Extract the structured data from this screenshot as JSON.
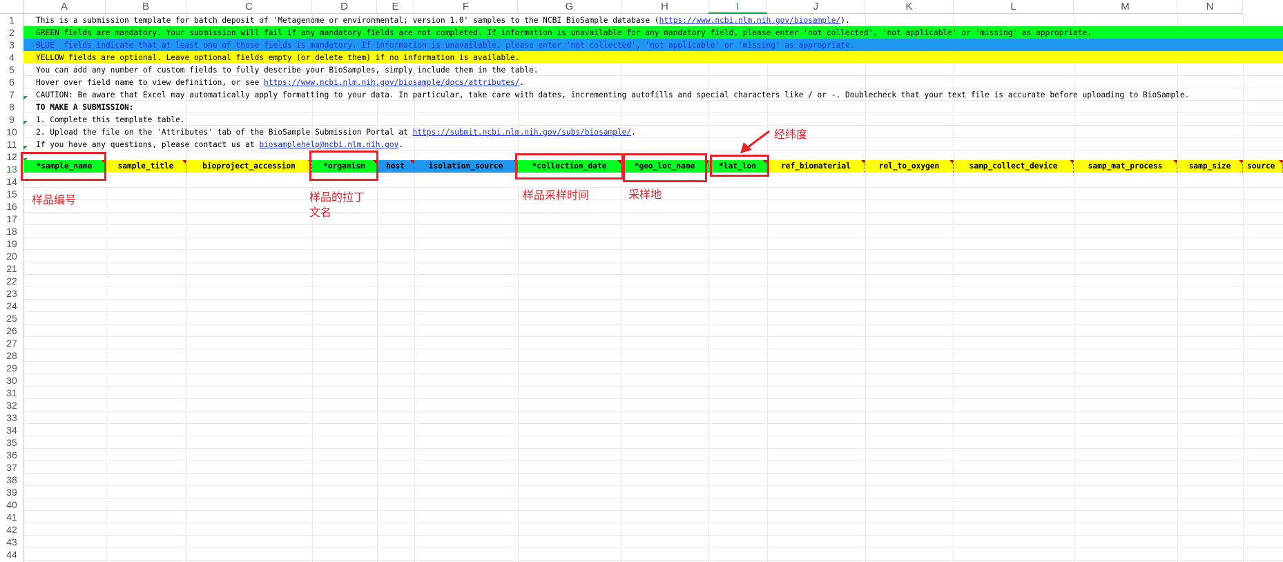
{
  "columns": [
    "A",
    "B",
    "C",
    "D",
    "E",
    "F",
    "G",
    "H",
    "I",
    "J",
    "K",
    "L",
    "M",
    "N"
  ],
  "selected_column": "I",
  "rows": [
    "1",
    "2",
    "3",
    "4",
    "5",
    "6",
    "7",
    "8",
    "9",
    "10",
    "11",
    "12",
    "13",
    "14",
    "15",
    "16",
    "17",
    "18",
    "19",
    "20",
    "21",
    "22",
    "23",
    "24",
    "25",
    "26",
    "27",
    "28",
    "29",
    "30",
    "31",
    "32",
    "33",
    "34",
    "35",
    "36",
    "37",
    "38",
    "39",
    "40",
    "41",
    "42",
    "43",
    "44"
  ],
  "selected_row": "13",
  "info_lines": {
    "line1_pre": "This is a submission template for batch deposit of 'Metagenome or environmental; version 1.0' samples to the NCBI BioSample database (",
    "line1_link": "https://www.ncbi.nlm.nih.gov/biosample/",
    "line1_post": ").",
    "line2": "GREEN fields are mandatory. Your submission will fail if any mandatory fields are not completed. If information is unavailable for any mandatory field, please enter 'not collected', 'not applicable' or 'missing' as appropriate.",
    "line3": "BLUE  fields indicate that at least one of those fields is mandatory. If information is unavailable, please enter 'not collected', 'not applicable' or 'missing' as appropriate.",
    "line4": "YELLOW fields are optional. Leave optional fields empty (or delete them) if no information is available.",
    "line5": "You can add any number of custom fields to fully describe your BioSamples, simply include them in the table.",
    "line6_pre": "Hover over field name to view definition, or see ",
    "line6_link": "https://www.ncbi.nlm.nih.gov/biosample/docs/attributes/",
    "line6_post": ".",
    "line7": "CAUTION: Be aware that Excel may automatically apply formatting to your data. In particular, take care with dates, incrementing autofills and special characters like / or -. Doublecheck that your text file is accurate before uploading to BioSample.",
    "line8": "TO MAKE A SUBMISSION:",
    "line9": "1. Complete this template table.",
    "line10_pre": "2. Upload the file on the 'Attributes' tab of the BioSample Submission Portal at ",
    "line10_link": "https://submit.ncbi.nlm.nih.gov/subs/biosample/",
    "line10_post": ".",
    "line11_pre": "If you have any questions, please contact us at ",
    "line11_link": "biosamplehelp@ncbi.nlm.nih.gov",
    "line11_post": "."
  },
  "header_fields": [
    {
      "name": "*sample_name",
      "color": "green"
    },
    {
      "name": "sample_title",
      "color": "yellow"
    },
    {
      "name": "bioproject_accession",
      "color": "yellow"
    },
    {
      "name": "*organism",
      "color": "green"
    },
    {
      "name": "host",
      "color": "blue"
    },
    {
      "name": "isolation_source",
      "color": "blue"
    },
    {
      "name": "*collection_date",
      "color": "green"
    },
    {
      "name": "*geo_loc_name",
      "color": "green"
    },
    {
      "name": "*lat_lon",
      "color": "green"
    },
    {
      "name": "ref_biomaterial",
      "color": "yellow"
    },
    {
      "name": "rel_to_oxygen",
      "color": "yellow"
    },
    {
      "name": "samp_collect_device",
      "color": "yellow"
    },
    {
      "name": "samp_mat_process",
      "color": "yellow"
    },
    {
      "name": "samp_size",
      "color": "yellow"
    },
    {
      "name": "source",
      "color": "yellow"
    }
  ],
  "annotations": {
    "sample_name": "样品编号",
    "organism_line1": "样品的拉丁",
    "organism_line2": "文名",
    "collection_date": "样品采样时间",
    "geo_loc_name": "采样地",
    "lat_lon": "经纬度"
  },
  "colors": {
    "green": "#00ff21",
    "blue": "#1f97f0",
    "yellow": "#ffff00",
    "annotation_red": "#e8212b",
    "link_blue": "#1a2ee0",
    "selected_green": "#1f9c46"
  }
}
